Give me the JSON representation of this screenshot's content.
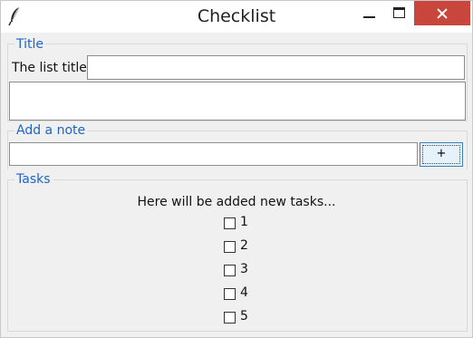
{
  "window": {
    "title": "Checklist"
  },
  "title_section": {
    "legend": "Title",
    "list_title_label": "The list title:",
    "list_title_value": ""
  },
  "note_section": {
    "legend": "Add a note",
    "note_value": "",
    "add_button_label": "+"
  },
  "tasks_section": {
    "legend": "Tasks",
    "placeholder_text": "Here will be added new tasks...",
    "tasks": [
      {
        "label": "1",
        "checked": false
      },
      {
        "label": "2",
        "checked": false
      },
      {
        "label": "3",
        "checked": false
      },
      {
        "label": "4",
        "checked": false
      },
      {
        "label": "5",
        "checked": false
      }
    ]
  },
  "colors": {
    "legend": "#1e64c8",
    "close_button": "#c9463d",
    "window_bg": "#f0f0f0"
  }
}
